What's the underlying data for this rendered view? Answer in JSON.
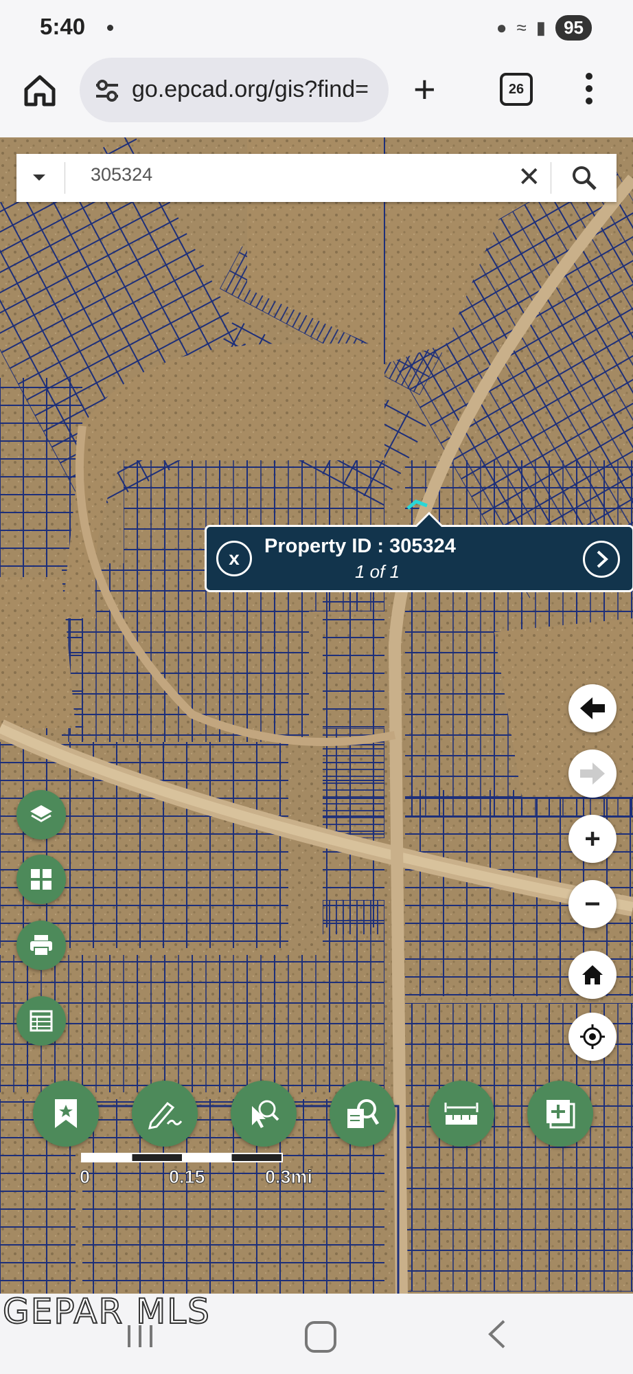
{
  "status_bar": {
    "time": "5:40",
    "battery": "95"
  },
  "browser": {
    "url": "go.epcad.org/gis?find=",
    "tab_count": "26"
  },
  "search": {
    "value": "305324"
  },
  "popup": {
    "title": "Property ID : 305324",
    "count": "1 of 1",
    "highlight_color": "#2ad7d7"
  },
  "scale_bar": {
    "labels": [
      "0",
      "0.15",
      "0.3mi"
    ]
  },
  "watermark": "GEPAR MLS",
  "map": {
    "parcel_line_color": "#1d2f7a",
    "terrain_color": "#a48a63"
  }
}
